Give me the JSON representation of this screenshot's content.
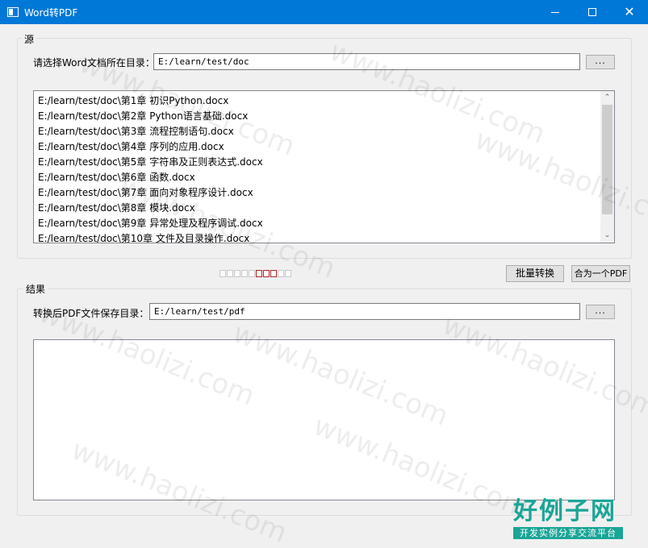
{
  "window": {
    "title": "Word转PDF",
    "minimize_symbol": "",
    "close_symbol": "✕"
  },
  "source": {
    "group_title": "源",
    "dir_label": "请选择Word文档所在目录：",
    "dir_value": "E:/learn/test/doc",
    "browse_label": "...",
    "files": [
      "E:/learn/test/doc\\第1章  初识Python.docx",
      "E:/learn/test/doc\\第2章  Python语言基础.docx",
      "E:/learn/test/doc\\第3章  流程控制语句.docx",
      "E:/learn/test/doc\\第4章  序列的应用.docx",
      "E:/learn/test/doc\\第5章  字符串及正则表达式.docx",
      "E:/learn/test/doc\\第6章  函数.docx",
      "E:/learn/test/doc\\第7章  面向对象程序设计.docx",
      "E:/learn/test/doc\\第8章  模块.docx",
      "E:/learn/test/doc\\第9章  异常处理及程序调试.docx",
      "E:/learn/test/doc\\第10章  文件及目录操作.docx"
    ],
    "scroll_up_symbol": "⌃",
    "scroll_down_symbol": "⌄"
  },
  "progress": {
    "total_cells": 10,
    "active_cells": [
      5,
      6,
      7
    ]
  },
  "actions": {
    "batch_convert_label": "批量转换",
    "merge_label": "合为一个PDF"
  },
  "result": {
    "group_title": "结果",
    "dir_label": "转换后PDF文件保存目录：",
    "dir_value": "E:/learn/test/pdf",
    "browse_label": "..."
  },
  "watermark": {
    "text": "www.haolizi.com",
    "logo_main": "好例子网",
    "logo_sub": "开发实例分享交流平台",
    "color": "#1aa597"
  },
  "colors": {
    "titlebar": "#0078d7",
    "progress_active": "#b0282a"
  }
}
